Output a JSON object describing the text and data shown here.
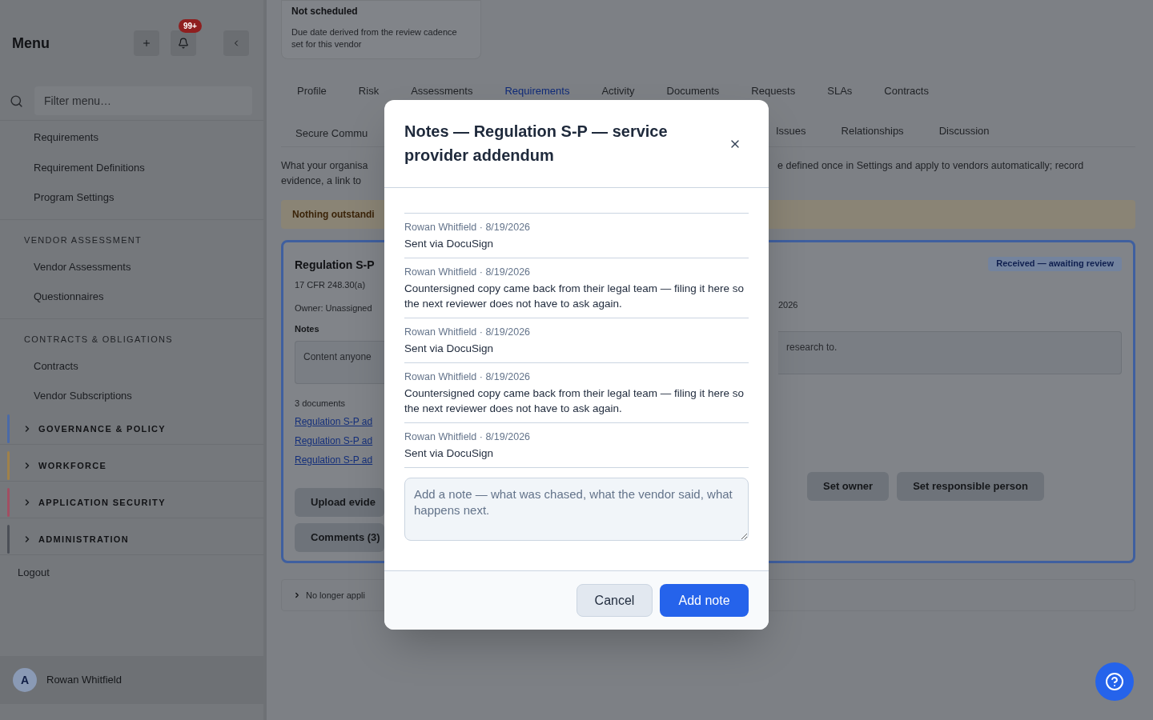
{
  "sidebar": {
    "title": "Menu",
    "notification_badge": "99+",
    "filter": {
      "placeholder": "Filter menu…"
    },
    "items": [
      {
        "kind": "link",
        "label": "Requirements"
      },
      {
        "kind": "link",
        "label": "Requirement Definitions"
      },
      {
        "kind": "link",
        "label": "Program Settings"
      },
      {
        "kind": "heading",
        "label": "VENDOR ASSESSMENT"
      },
      {
        "kind": "link",
        "label": "Vendor Assessments"
      },
      {
        "kind": "link",
        "label": "Questionnaires"
      },
      {
        "kind": "heading",
        "label": "CONTRACTS & OBLIGATIONS"
      },
      {
        "kind": "link",
        "label": "Contracts"
      },
      {
        "kind": "link",
        "label": "Vendor Subscriptions"
      },
      {
        "kind": "group",
        "label": "GOVERNANCE & POLICY",
        "color": "#4a6aa8",
        "expanded": false
      },
      {
        "kind": "group",
        "label": "WORKFORCE",
        "color": "#a0814a",
        "expanded": false
      },
      {
        "kind": "group",
        "label": "APPLICATION SECURITY",
        "color": "#a24e62",
        "expanded": false
      },
      {
        "kind": "group",
        "label": "ADMINISTRATION",
        "color": "#4b4f57",
        "expanded": false
      }
    ],
    "logout": "Logout",
    "user": {
      "initial": "A",
      "name": "Rowan Whitfield"
    }
  },
  "main": {
    "schedule_card": {
      "title": "Not scheduled",
      "text": "Due date derived from the review cadence set for this vendor"
    },
    "tabs": [
      {
        "label": "Profile",
        "selected": false
      },
      {
        "label": "Risk",
        "selected": false
      },
      {
        "label": "Assessments",
        "selected": false
      },
      {
        "label": "Requirements",
        "selected": true
      },
      {
        "label": "Activity",
        "selected": false
      },
      {
        "label": "Documents",
        "selected": false
      },
      {
        "label": "Requests",
        "selected": false
      },
      {
        "label": "SLAs",
        "selected": false
      },
      {
        "label": "Contracts",
        "selected": false
      }
    ],
    "tabs_row_2": {
      "left": [
        "Secure Commu"
      ],
      "right": [
        "Issues",
        "Relationships",
        "Discussion"
      ]
    },
    "description": {
      "left": [
        "What your organisa",
        "evidence, a link to"
      ],
      "right": "e defined once in Settings and apply to vendors automatically; record"
    },
    "banner": "Nothing outstandi",
    "requirement_card": {
      "title": "Regulation S-P",
      "subtitle": "17 CFR 248.30(a)",
      "owner": "Owner: Unassigned",
      "notes_label": "Notes",
      "notes_placeholder_left": "Content anyone",
      "notes_placeholder_right": "research to.",
      "status": "Received — awaiting review",
      "date_fragment": "2026",
      "documents_label": "3 documents",
      "documents": [
        "Regulation S-P ad",
        "Regulation S-P ad",
        "Regulation S-P ad"
      ],
      "left_buttons": [
        "Upload evide",
        "Comments (3)"
      ],
      "right_buttons": [
        "Set owner",
        "Set responsible person"
      ]
    },
    "collapsed_row": "No longer appli"
  },
  "dialog": {
    "title": "Notes — Regulation S-P — service provider addendum",
    "notes": [
      {
        "meta": "Rowan Whitfield · 8/19/2026",
        "text": "Sent via DocuSign"
      },
      {
        "meta": "Rowan Whitfield · 8/19/2026",
        "text": "Countersigned copy came back from their legal team — filing it here so the next reviewer does not have to ask again."
      },
      {
        "meta": "Rowan Whitfield · 8/19/2026",
        "text": "Sent via DocuSign"
      },
      {
        "meta": "Rowan Whitfield · 8/19/2026",
        "text": "Countersigned copy came back from their legal team — filing it here so the next reviewer does not have to ask again."
      },
      {
        "meta": "Rowan Whitfield · 8/19/2026",
        "text": "Sent via DocuSign"
      }
    ],
    "note_field": {
      "placeholder": "Add a note — what was chased, what the vendor said, what happens next."
    },
    "buttons": [
      {
        "kind": "secondary",
        "label": "Cancel"
      },
      {
        "kind": "primary",
        "label": "Add note"
      }
    ]
  }
}
